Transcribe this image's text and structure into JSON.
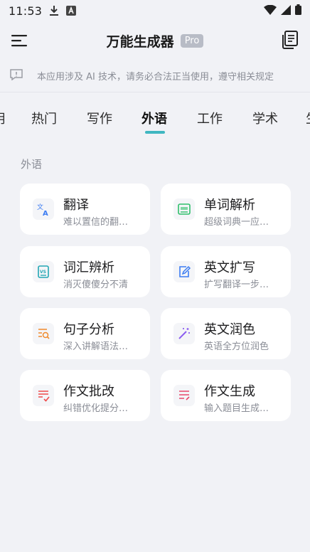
{
  "status_bar": {
    "time": "11:53"
  },
  "header": {
    "title": "万能生成器",
    "pro_badge": "Pro"
  },
  "notice": {
    "text": "本应用涉及 AI 技术，请务必合法正当使用，遵守相关规定"
  },
  "tabs": [
    "用",
    "热门",
    "写作",
    "外语",
    "工作",
    "学术",
    "生"
  ],
  "active_tab": "外语",
  "section": {
    "title": "外语"
  },
  "tools": [
    {
      "name": "翻译",
      "desc": "难以置信的翻…",
      "icon": "translate-icon",
      "color": "#3d7df2"
    },
    {
      "name": "单词解析",
      "desc": "超级词典一应…",
      "icon": "word-card-icon",
      "color": "#2fbf6b"
    },
    {
      "name": "词汇辨析",
      "desc": "消灭傻傻分不清",
      "icon": "vs-compare-icon",
      "color": "#23a7b4"
    },
    {
      "name": "英文扩写",
      "desc": "扩写翻译一步…",
      "icon": "edit-expand-icon",
      "color": "#3d7df2"
    },
    {
      "name": "句子分析",
      "desc": "深入讲解语法…",
      "icon": "sentence-search-icon",
      "color": "#f08a2c"
    },
    {
      "name": "英文润色",
      "desc": "英语全方位润色",
      "icon": "magic-wand-icon",
      "color": "#8a5cf0"
    },
    {
      "name": "作文批改",
      "desc": "纠错优化提分…",
      "icon": "essay-check-icon",
      "color": "#ef4b4b"
    },
    {
      "name": "作文生成",
      "desc": "输入题目生成…",
      "icon": "essay-generate-icon",
      "color": "#e8476b"
    }
  ]
}
